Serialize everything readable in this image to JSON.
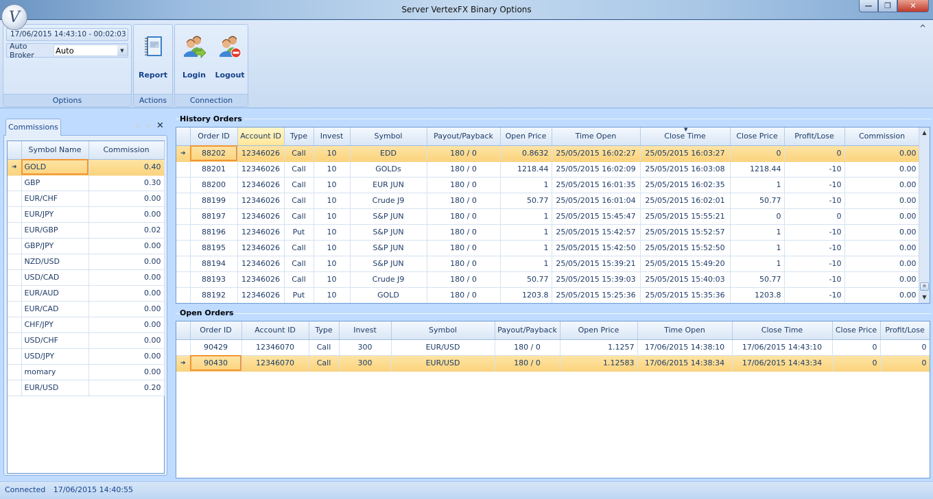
{
  "window": {
    "title": "Server VertexFX Binary Options",
    "controls": {
      "minimize": "—",
      "restore": "❐",
      "close": "✕"
    },
    "orb_glyph": "V"
  },
  "ribbon": {
    "datetime": "17/06/2015 14:43:10  - 00:02:03",
    "auto_broker_label": "Auto Broker",
    "auto_broker_value": "Auto",
    "groups": {
      "options": "Options",
      "actions": "Actions",
      "connection": "Connection"
    },
    "buttons": {
      "report": "Report",
      "login": "Login",
      "logout": "Logout"
    },
    "collapse_icon": "^"
  },
  "commissions": {
    "tab_label": "Commissions",
    "close_glyph": "✕",
    "columns": [
      "Symbol Name",
      "Commission"
    ],
    "selected_index": 0,
    "rows": [
      {
        "symbol": "GOLD",
        "commission": "0.40"
      },
      {
        "symbol": "GBP",
        "commission": "0.30"
      },
      {
        "symbol": "EUR/CHF",
        "commission": "0.00"
      },
      {
        "symbol": "EUR/JPY",
        "commission": "0.00"
      },
      {
        "symbol": "EUR/GBP",
        "commission": "0.02"
      },
      {
        "symbol": "GBP/JPY",
        "commission": "0.00"
      },
      {
        "symbol": "NZD/USD",
        "commission": "0.00"
      },
      {
        "symbol": "USD/CAD",
        "commission": "0.00"
      },
      {
        "symbol": "EUR/AUD",
        "commission": "0.00"
      },
      {
        "symbol": "EUR/CAD",
        "commission": "0.00"
      },
      {
        "symbol": "CHF/JPY",
        "commission": "0.00"
      },
      {
        "symbol": "USD/CHF",
        "commission": "0.00"
      },
      {
        "symbol": "USD/JPY",
        "commission": "0.00"
      },
      {
        "symbol": "momary",
        "commission": "0.00"
      },
      {
        "symbol": "EUR/USD",
        "commission": "0.20"
      }
    ]
  },
  "history_orders": {
    "title": "History Orders",
    "columns": [
      "Order ID",
      "Account ID",
      "Type",
      "Invest",
      "Symbol",
      "Payout/Payback",
      "Open Price",
      "Time Open",
      "Close Time",
      "Close Price",
      "Profit/Lose",
      "Commission"
    ],
    "sorted_column": "Close Time",
    "highlighted_column": "Account ID",
    "selected_index": 0,
    "rows": [
      [
        "88202",
        "12346026",
        "Call",
        "10",
        "EDD",
        "180 / 0",
        "0.8632",
        "25/05/2015 16:02:27",
        "25/05/2015 16:03:27",
        "0",
        "0",
        "0.00"
      ],
      [
        "88201",
        "12346026",
        "Call",
        "10",
        "GOLDs",
        "180 / 0",
        "1218.44",
        "25/05/2015 16:02:09",
        "25/05/2015 16:03:08",
        "1218.44",
        "-10",
        "0.00"
      ],
      [
        "88200",
        "12346026",
        "Call",
        "10",
        "EUR JUN",
        "180 / 0",
        "1",
        "25/05/2015 16:01:35",
        "25/05/2015 16:02:35",
        "1",
        "-10",
        "0.00"
      ],
      [
        "88199",
        "12346026",
        "Call",
        "10",
        "Crude J9",
        "180 / 0",
        "50.77",
        "25/05/2015 16:01:04",
        "25/05/2015 16:02:01",
        "50.77",
        "-10",
        "0.00"
      ],
      [
        "88197",
        "12346026",
        "Call",
        "10",
        "S&P JUN",
        "180 / 0",
        "1",
        "25/05/2015 15:45:47",
        "25/05/2015 15:55:21",
        "0",
        "0",
        "0.00"
      ],
      [
        "88196",
        "12346026",
        "Put",
        "10",
        "S&P JUN",
        "180 / 0",
        "1",
        "25/05/2015 15:42:57",
        "25/05/2015 15:52:57",
        "1",
        "-10",
        "0.00"
      ],
      [
        "88195",
        "12346026",
        "Call",
        "10",
        "S&P JUN",
        "180 / 0",
        "1",
        "25/05/2015 15:42:50",
        "25/05/2015 15:52:50",
        "1",
        "-10",
        "0.00"
      ],
      [
        "88194",
        "12346026",
        "Call",
        "10",
        "S&P JUN",
        "180 / 0",
        "1",
        "25/05/2015 15:39:21",
        "25/05/2015 15:49:20",
        "1",
        "-10",
        "0.00"
      ],
      [
        "88193",
        "12346026",
        "Call",
        "10",
        "Crude J9",
        "180 / 0",
        "50.77",
        "25/05/2015 15:39:03",
        "25/05/2015 15:40:03",
        "50.77",
        "-10",
        "0.00"
      ],
      [
        "88192",
        "12346026",
        "Put",
        "10",
        "GOLD",
        "180 / 0",
        "1203.8",
        "25/05/2015 15:25:36",
        "25/05/2015 15:35:36",
        "1203.8",
        "-10",
        "0.00"
      ]
    ]
  },
  "open_orders": {
    "title": "Open Orders",
    "columns": [
      "Order ID",
      "Account ID",
      "Type",
      "Invest",
      "Symbol",
      "Payout/Payback",
      "Open Price",
      "Time Open",
      "Close Time",
      "Close Price",
      "Profit/Lose"
    ],
    "selected_index": 1,
    "rows": [
      [
        "90429",
        "12346070",
        "Call",
        "300",
        "EUR/USD",
        "180 / 0",
        "1.1257",
        "17/06/2015 14:38:10",
        "17/06/2015 14:43:10",
        "0",
        "0"
      ],
      [
        "90430",
        "12346070",
        "Call",
        "300",
        "EUR/USD",
        "180 / 0",
        "1.12583",
        "17/06/2015 14:38:34",
        "17/06/2015 14:43:34",
        "0",
        "0"
      ]
    ]
  },
  "statusbar": {
    "status": "Connected",
    "timestamp": "17/06/2015 14:40:55"
  },
  "colors": {
    "selection": "#fbd47e",
    "focus_border": "#f29536",
    "text": "#1d3a66",
    "panel_bg": "#bfdbff"
  }
}
